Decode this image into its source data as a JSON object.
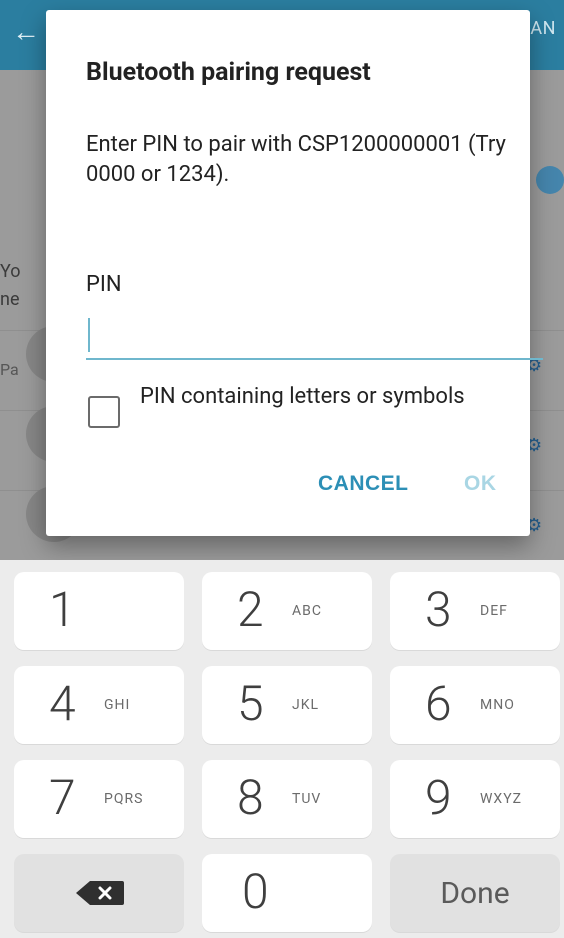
{
  "background": {
    "appbar": {
      "back_glyph": "←",
      "right_text": "AN"
    },
    "content": {
      "partial_text_lines": [
        "Yo",
        "ne"
      ],
      "section_label": "Pa"
    }
  },
  "dialog": {
    "title": "Bluetooth pairing request",
    "message": "Enter PIN to pair with CSP1200000001 (Try 0000 or 1234).",
    "pin_label": "PIN",
    "pin_value": "",
    "checkbox_label": "PIN containing letters or symbols",
    "checkbox_checked": false,
    "buttons": {
      "cancel": "CANCEL",
      "ok": "OK"
    },
    "colors": {
      "accent": "#2c8fb6",
      "ok_disabled": "#a9d6e4",
      "input_underline": "#6fb7cd"
    }
  },
  "keyboard": {
    "rows": [
      [
        {
          "digit": "1",
          "letters": ""
        },
        {
          "digit": "2",
          "letters": "ABC"
        },
        {
          "digit": "3",
          "letters": "DEF"
        }
      ],
      [
        {
          "digit": "4",
          "letters": "GHI"
        },
        {
          "digit": "5",
          "letters": "JKL"
        },
        {
          "digit": "6",
          "letters": "MNO"
        }
      ],
      [
        {
          "digit": "7",
          "letters": "PQRS"
        },
        {
          "digit": "8",
          "letters": "TUV"
        },
        {
          "digit": "9",
          "letters": "WXYZ"
        }
      ]
    ],
    "bottom": {
      "backspace_icon": "backspace-icon",
      "zero": "0",
      "done": "Done"
    }
  }
}
